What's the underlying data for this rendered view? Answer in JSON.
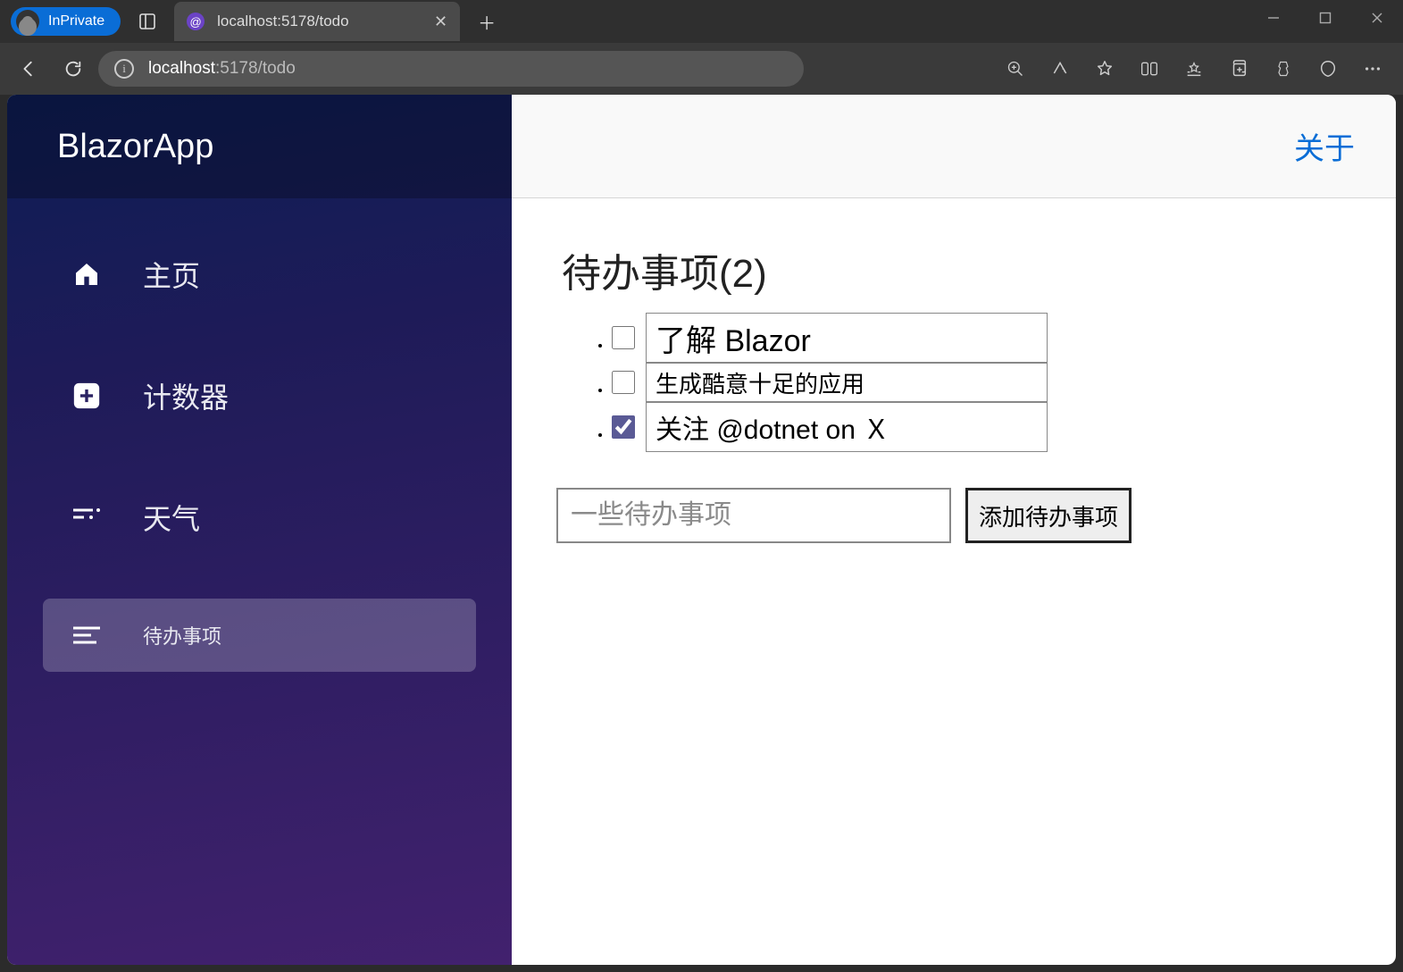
{
  "browser": {
    "inprivate_label": "InPrivate",
    "tab_title": "localhost:5178/todo",
    "url_host": "localhost",
    "url_path": ":5178/todo"
  },
  "sidebar": {
    "brand": "BlazorApp",
    "items": [
      {
        "label": "主页",
        "icon": "home"
      },
      {
        "label": "计数器",
        "icon": "plus"
      },
      {
        "label": "天气",
        "icon": "list"
      },
      {
        "label": "待办事项",
        "icon": "menu",
        "active": true
      }
    ]
  },
  "topbar": {
    "about_label": "关于"
  },
  "page": {
    "title_prefix": "待办事项",
    "remaining_count": 2,
    "todos": [
      {
        "text": "了解 Blazor",
        "done": false
      },
      {
        "text": "生成酷意十足的应用",
        "done": false
      },
      {
        "text": "关注 @dotnet on Ｘ",
        "done": true
      }
    ],
    "new_placeholder": "一些待办事项",
    "add_button_label": "添加待办事项"
  }
}
